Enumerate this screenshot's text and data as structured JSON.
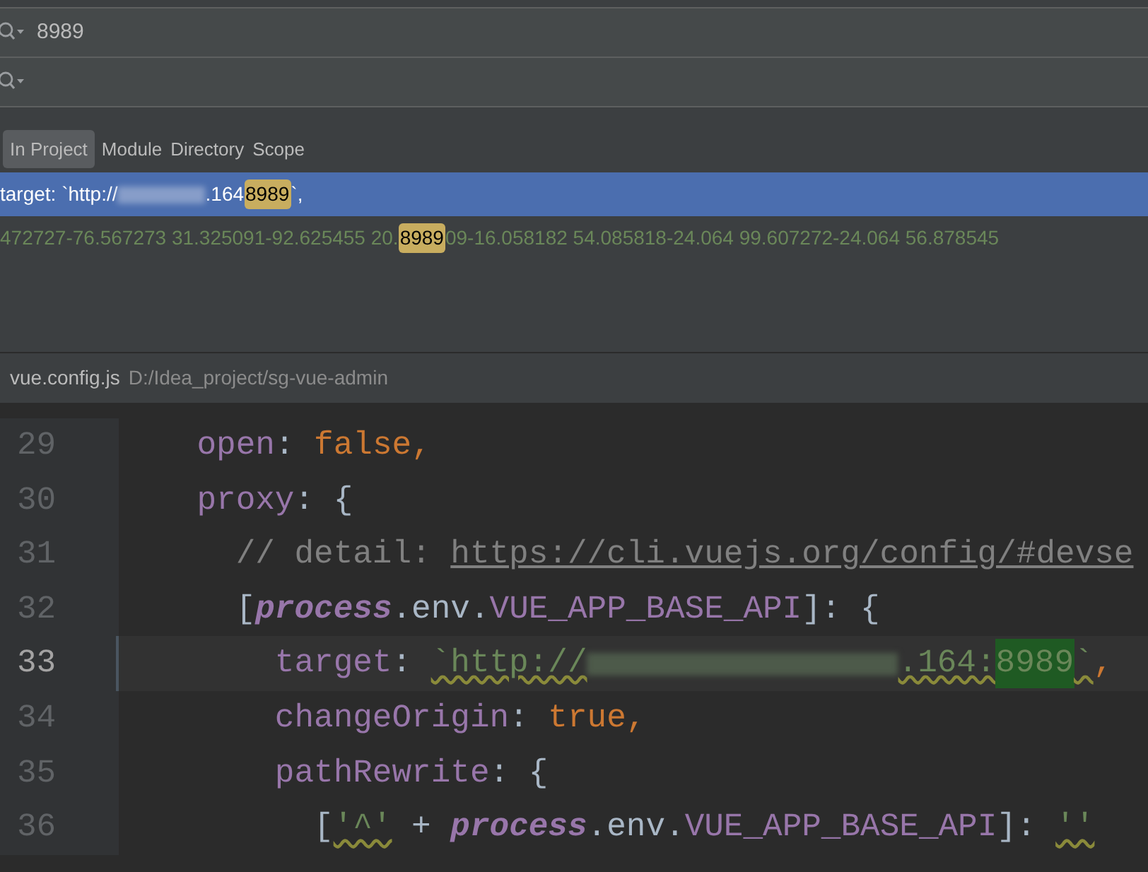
{
  "search": {
    "query": "8989"
  },
  "scopes": [
    {
      "label": "In Project",
      "selected": true
    },
    {
      "label": "Module",
      "selected": false
    },
    {
      "label": "Directory",
      "selected": false
    },
    {
      "label": "Scope",
      "selected": false
    }
  ],
  "results": [
    {
      "selected": true,
      "parts": [
        {
          "kind": "text",
          "text": "target: `http://"
        },
        {
          "kind": "redacted"
        },
        {
          "kind": "text",
          "text": ".164"
        },
        {
          "kind": "match",
          "text": "8989"
        },
        {
          "kind": "text",
          "text": "`,"
        }
      ]
    },
    {
      "selected": false,
      "parts": [
        {
          "kind": "text",
          "text": "472727-76.567273 31.325091-92.625455 20."
        },
        {
          "kind": "match",
          "text": "8989"
        },
        {
          "kind": "text",
          "text": "09-16.058182 54.085818-24.064 99.607272-24.064 56.878545"
        }
      ]
    }
  ],
  "file_header": {
    "file_name": "vue.config.js",
    "path": "D:/Idea_project/sg-vue-admin"
  },
  "editor_lines": [
    {
      "number": "29",
      "current": false,
      "tokens": [
        {
          "kind": "property",
          "text": "    open"
        },
        {
          "kind": "plain",
          "text": ": "
        },
        {
          "kind": "keyword",
          "text": "false,"
        }
      ]
    },
    {
      "number": "30",
      "current": false,
      "tokens": [
        {
          "kind": "property",
          "text": "    proxy"
        },
        {
          "kind": "plain",
          "text": ": {"
        }
      ]
    },
    {
      "number": "31",
      "current": false,
      "tokens": [
        {
          "kind": "comment",
          "text": "      // detail: "
        },
        {
          "kind": "link",
          "text": "https://cli.vuejs.org/config/#devse"
        }
      ]
    },
    {
      "number": "32",
      "current": false,
      "tokens": [
        {
          "kind": "plain",
          "text": "      ["
        },
        {
          "kind": "italic",
          "text": "process"
        },
        {
          "kind": "plain",
          "text": ".env."
        },
        {
          "kind": "property",
          "text": "VUE_APP_BASE_API"
        },
        {
          "kind": "plain",
          "text": "]: {"
        }
      ]
    },
    {
      "number": "33",
      "current": true,
      "tokens": [
        {
          "kind": "property",
          "text": "        target"
        },
        {
          "kind": "plain",
          "text": ": "
        },
        {
          "kind": "string",
          "text": "`http://"
        },
        {
          "kind": "redacted"
        },
        {
          "kind": "string",
          "text": ".164:"
        },
        {
          "kind": "match",
          "text": "8989"
        },
        {
          "kind": "string",
          "text": "`"
        },
        {
          "kind": "keyword",
          "text": ","
        }
      ]
    },
    {
      "number": "34",
      "current": false,
      "tokens": [
        {
          "kind": "property",
          "text": "        changeOrigin"
        },
        {
          "kind": "plain",
          "text": ": "
        },
        {
          "kind": "keyword",
          "text": "true,"
        }
      ]
    },
    {
      "number": "35",
      "current": false,
      "tokens": [
        {
          "kind": "property",
          "text": "        pathRewrite"
        },
        {
          "kind": "plain",
          "text": ": {"
        }
      ]
    },
    {
      "number": "36",
      "current": false,
      "tokens": [
        {
          "kind": "plain",
          "text": "          ["
        },
        {
          "kind": "string",
          "text": "'^'"
        },
        {
          "kind": "plain",
          "text": " + "
        },
        {
          "kind": "italic",
          "text": "process"
        },
        {
          "kind": "plain",
          "text": ".env."
        },
        {
          "kind": "property",
          "text": "VUE_APP_BASE_API"
        },
        {
          "kind": "plain",
          "text": "]: "
        },
        {
          "kind": "string",
          "text": "''"
        }
      ]
    }
  ]
}
